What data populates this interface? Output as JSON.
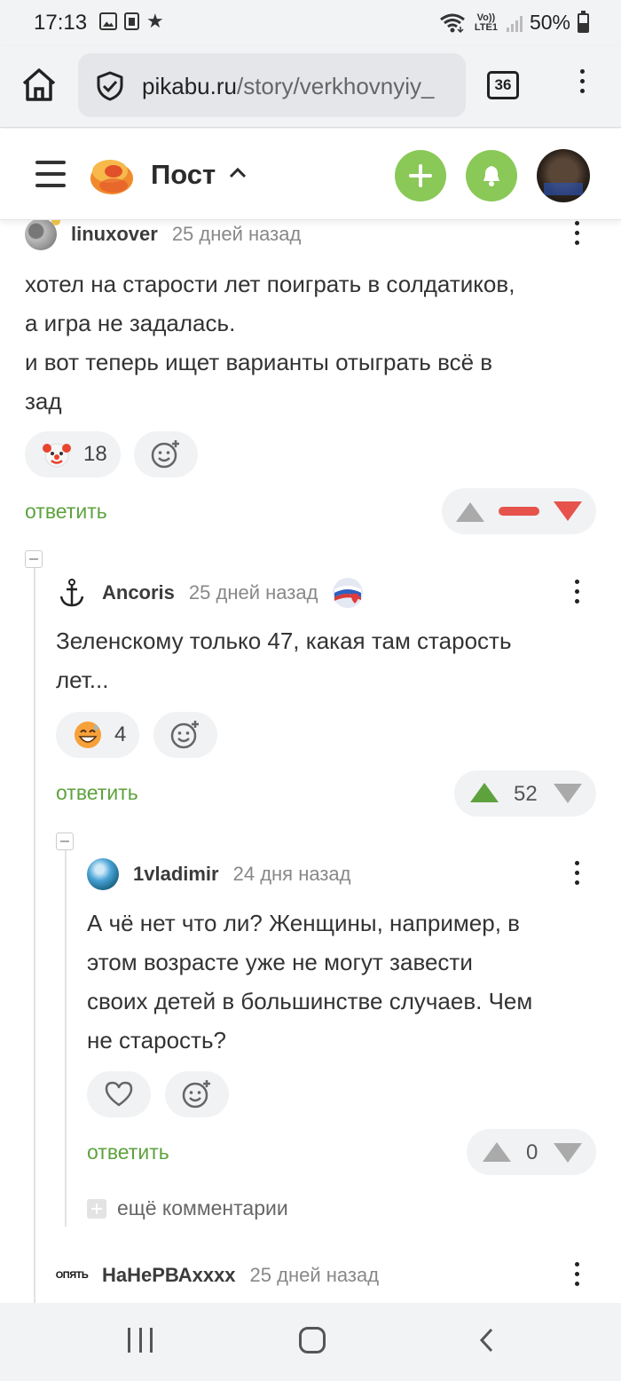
{
  "status_bar": {
    "time": "17:13",
    "network": "Vo)) LTE1",
    "battery": "50%"
  },
  "browser": {
    "url_host": "pikabu.ru",
    "url_path": "/story/verkhovnyiy_",
    "tab_count": "36"
  },
  "header": {
    "title": "Пост"
  },
  "comments": [
    {
      "author": "linuxover",
      "time": "25 дней назад",
      "text_lines": [
        "хотел на старости лет поиграть в солдатиков,",
        "а игра не задалась.",
        "и вот теперь ищет варианты отыграть всё в",
        "зад"
      ],
      "reaction": {
        "icon": "clown-emoji-icon",
        "count": "18"
      },
      "reply": "ответить",
      "vote": {
        "state": "downvoted",
        "count": ""
      }
    },
    {
      "author": "Ancoris",
      "time": "25 дней назад",
      "text_lines": [
        "Зеленскому только 47, какая там старость",
        "лет..."
      ],
      "reaction": {
        "icon": "grinning-sweat-emoji-icon",
        "count": "4"
      },
      "reply": "ответить",
      "vote": {
        "state": "upvoted",
        "count": "52"
      }
    },
    {
      "author": "1vladimir",
      "time": "24 дня назад",
      "text_lines": [
        "А чё нет что ли? Женщины, например, в",
        "этом возрасте уже не могут завести",
        "своих детей в большинстве случаев. Чем",
        "не старость?"
      ],
      "reaction": {
        "icon": "heart-icon",
        "count": ""
      },
      "reply": "ответить",
      "vote": {
        "state": "neutral",
        "count": "0"
      }
    },
    {
      "author": "НаНеРВАхххх",
      "time": "25 дней назад",
      "avatar_text": "ОПЯТЬ"
    }
  ],
  "more_comments": "ещё комментарии",
  "colors": {
    "accent_green": "#8ac858",
    "reply_green": "#5ea23e",
    "downvote_red": "#e5534b",
    "upvote_green": "#5ea23e"
  }
}
